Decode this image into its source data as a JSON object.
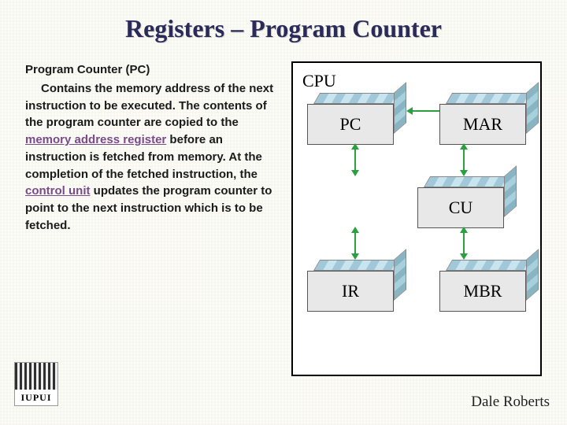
{
  "title": "Registers – Program Counter",
  "content": {
    "subtitle": "Program Counter (PC)",
    "para_pre": "Contains the memory address of the next instruction to be executed. The contents of the program counter are copied to the ",
    "link1": "memory address register",
    "para_mid": " before an instruction is fetched from memory. At the completion of the fetched instruction, the ",
    "link2": "control unit",
    "para_post": " updates the program counter to point to the next instruction which is to be fetched."
  },
  "diagram": {
    "cpu": "CPU",
    "pc": "PC",
    "mar": "MAR",
    "cu": "CU",
    "ir": "IR",
    "mbr": "MBR"
  },
  "logo_text": "IUPUI",
  "author": "Dale Roberts"
}
